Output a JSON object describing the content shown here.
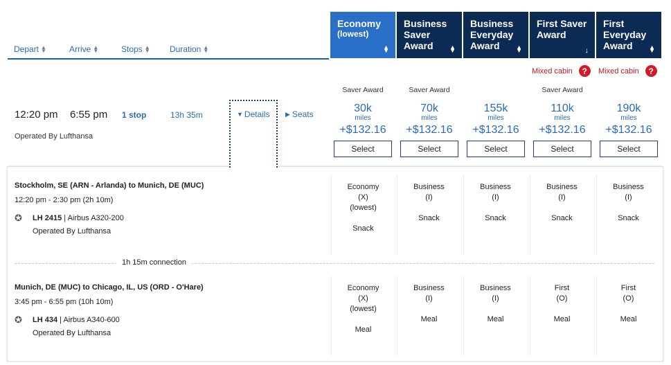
{
  "sort": {
    "depart": "Depart",
    "arrive": "Arrive",
    "stops": "Stops",
    "duration": "Duration"
  },
  "cabins": [
    {
      "line1": "Economy",
      "line2": "(lowest)",
      "sort_icon": "sort-updown-icon"
    },
    {
      "line1": "Business",
      "line2": "Saver",
      "line3": "Award",
      "sort_icon": "sort-updown-icon"
    },
    {
      "line1": "Business",
      "line2": "Everyday",
      "line3": "Award",
      "sort_icon": "sort-updown-icon"
    },
    {
      "line1": "First Saver",
      "line2": "Award",
      "sort_icon": "sort-down-icon"
    },
    {
      "line1": "First",
      "line2": "Everyday",
      "line3": "Award",
      "sort_icon": "sort-updown-icon"
    }
  ],
  "mixed_cabin": "Mixed cabin",
  "flight": {
    "depart": "12:20 pm",
    "arrive": "6:55 pm",
    "stops": "1 stop",
    "duration": "13h 35m",
    "operated_by": "Operated By Lufthansa",
    "details": "Details",
    "seats": "Seats"
  },
  "fares": [
    {
      "saver": "Saver Award",
      "miles": "30k",
      "miles_label": "miles",
      "price": "+$132.16",
      "select": "Select"
    },
    {
      "saver": "Saver Award",
      "miles": "70k",
      "miles_label": "miles",
      "price": "+$132.16",
      "select": "Select"
    },
    {
      "saver": "",
      "miles": "155k",
      "miles_label": "miles",
      "price": "+$132.16",
      "select": "Select"
    },
    {
      "saver": "Saver Award",
      "miles": "110k",
      "miles_label": "miles",
      "price": "+$132.16",
      "select": "Select"
    },
    {
      "saver": "",
      "miles": "190k",
      "miles_label": "miles",
      "price": "+$132.16",
      "select": "Select"
    }
  ],
  "segments": [
    {
      "route": "Stockholm, SE (ARN - Arlanda) to Munich, DE (MUC)",
      "time": "12:20 pm - 2:30 pm (2h 10m)",
      "flight_no": "LH 2415",
      "aircraft": "| Airbus A320-200",
      "operated_by": "Operated By Lufthansa",
      "cabins": [
        {
          "name": "Economy",
          "code": "(X)",
          "note": "(lowest)",
          "meal": "Snack"
        },
        {
          "name": "Business",
          "code": "(I)",
          "note": "",
          "meal": "Snack"
        },
        {
          "name": "Business",
          "code": "(I)",
          "note": "",
          "meal": "Snack"
        },
        {
          "name": "Business",
          "code": "(I)",
          "note": "",
          "meal": "Snack"
        },
        {
          "name": "Business",
          "code": "(I)",
          "note": "",
          "meal": "Snack"
        }
      ]
    },
    {
      "route": "Munich, DE (MUC) to Chicago, IL, US (ORD - O'Hare)",
      "time": "3:45 pm - 6:55 pm (10h 10m)",
      "flight_no": "LH 434",
      "aircraft": "| Airbus A340-600",
      "operated_by": "Operated By Lufthansa",
      "cabins": [
        {
          "name": "Economy",
          "code": "(X)",
          "note": "(lowest)",
          "meal": "Meal"
        },
        {
          "name": "Business",
          "code": "(I)",
          "note": "",
          "meal": "Meal"
        },
        {
          "name": "Business",
          "code": "(I)",
          "note": "",
          "meal": "Meal"
        },
        {
          "name": "First",
          "code": "(O)",
          "note": "",
          "meal": "Meal"
        },
        {
          "name": "First",
          "code": "(O)",
          "note": "",
          "meal": "Meal"
        }
      ]
    }
  ],
  "connection": "1h 15m connection",
  "colors": {
    "header_dark": "#0b2a54",
    "header_active": "#2a70c9",
    "link": "#2a6bb5",
    "alert": "#c0162b"
  }
}
